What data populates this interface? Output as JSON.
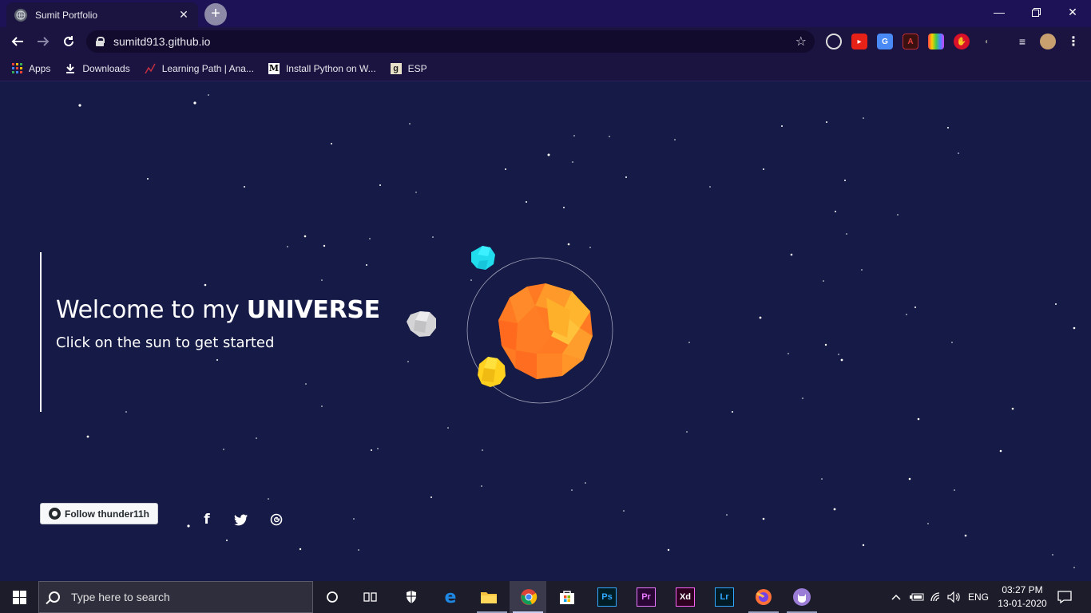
{
  "browser": {
    "tab_title": "Sumit Portfolio",
    "url": "sumitd913.github.io",
    "bookmarks": [
      "Apps",
      "Downloads",
      "Learning Path | Ana...",
      "Install Python on W...",
      "ESP"
    ]
  },
  "page": {
    "welcome_prefix": "Welcome to my ",
    "welcome_bold": "UNIVERSE",
    "subtitle": "Click on the sun to get started",
    "follow_label": "Follow thunder11h"
  },
  "taskbar": {
    "search_placeholder": "Type here to search",
    "language": "ENG",
    "time": "03:27 PM",
    "date": "13-01-2020"
  },
  "colors": {
    "background": "#151a46",
    "sun": "#ff7a1f",
    "planet_cyan": "#22e0f0",
    "planet_yellow": "#ffd21f",
    "planet_grey": "#d9d9d9"
  }
}
